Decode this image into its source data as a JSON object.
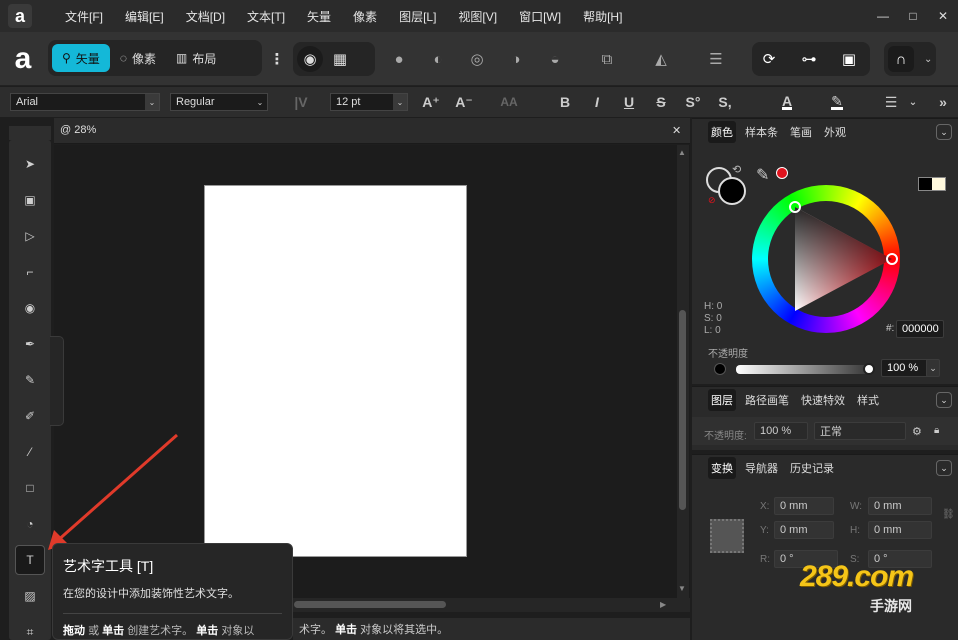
{
  "app": {
    "logo_letter": "a"
  },
  "menu": [
    "文件[F]",
    "编辑[E]",
    "文档[D]",
    "文本[T]",
    "矢量",
    "像素",
    "图层[L]",
    "视图[V]",
    "窗口[W]",
    "帮助[H]"
  ],
  "window_controls": {
    "minimize": "—",
    "maximize": "□",
    "close": "✕"
  },
  "personas": [
    {
      "label": "矢量",
      "icon": "vector-persona-icon",
      "active": true
    },
    {
      "label": "像素",
      "icon": "pixel-persona-icon",
      "active": false
    },
    {
      "label": "布局",
      "icon": "layout-persona-icon",
      "active": false
    }
  ],
  "context_bar": {
    "font_family": "Arial",
    "font_style": "Regular",
    "font_size": "12 pt",
    "dropdown_glyph": "⌄",
    "buttons": [
      "A⁺",
      "A⁻",
      "AA",
      "B",
      "I",
      "U",
      "S",
      "S°",
      "S,"
    ],
    "more": "»"
  },
  "document": {
    "tab_title": "@ 28%",
    "close": "✕"
  },
  "tooltip": {
    "title": "艺术字工具 [T]",
    "description": "在您的设计中添加装饰性艺术文字。",
    "hint_drag": "拖动",
    "hint_or": "或",
    "hint_click": "单击",
    "hint_rest": "创建艺术字。",
    "hint_click2": "单击",
    "hint_rest2": "对象以"
  },
  "status_bar": {
    "text_a": "术字。",
    "click": "单击",
    "text_b": "对象以将其选中。"
  },
  "color_panel": {
    "tabs": [
      "颜色",
      "样本条",
      "笔画",
      "外观"
    ],
    "hsl": {
      "h": "H: 0",
      "s": "S: 0",
      "l": "L: 0"
    },
    "hex_label": "#:",
    "hex_value": "000000",
    "opacity_label": "不透明度",
    "opacity_value": "100 %",
    "colors": {
      "picked": "#e0141e",
      "fill": "#000000"
    }
  },
  "layers_panel": {
    "tabs": [
      "图层",
      "路径画笔",
      "快速特效",
      "样式"
    ],
    "opacity_label": "不透明度:",
    "opacity_value": "100 %",
    "blend_mode": "正常"
  },
  "transform_panel": {
    "tabs": [
      "变换",
      "导航器",
      "历史记录"
    ],
    "x_label": "X:",
    "x_value": "0 mm",
    "y_label": "Y:",
    "y_value": "0 mm",
    "w_label": "W:",
    "w_value": "0 mm",
    "h_label": "H:",
    "h_value": "0 mm",
    "r_label": "R:",
    "r_value": "0 °",
    "s_label": "S:",
    "s_value": "0 °"
  },
  "watermark": {
    "main": "289.com",
    "sub": "手游网"
  }
}
